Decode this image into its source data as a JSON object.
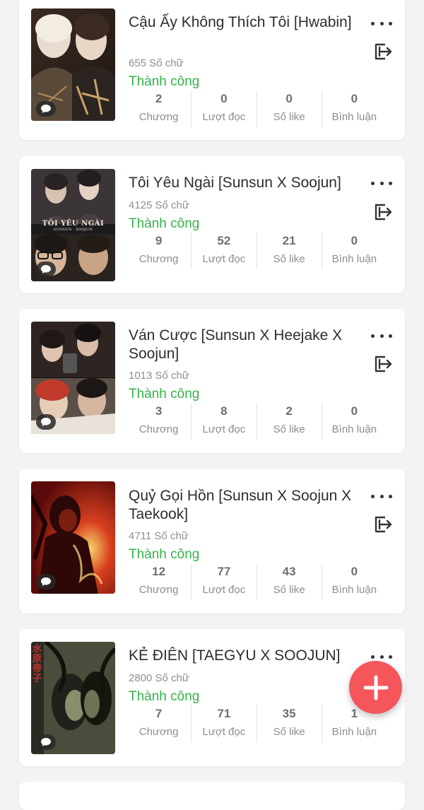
{
  "stories": [
    {
      "title": "Cậu Ấy Không Thích Tôi [Hwabin]",
      "word_count": "655 Số chữ",
      "status": "Thành công",
      "stats": [
        {
          "value": "2",
          "label": "Chương"
        },
        {
          "value": "0",
          "label": "Lượt đọc"
        },
        {
          "value": "0",
          "label": "Số like"
        },
        {
          "value": "0",
          "label": "Bình luận"
        }
      ]
    },
    {
      "title": "Tôi Yêu Ngài [Sunsun X Soojun]",
      "word_count": "4125 Số chữ",
      "status": "Thành công",
      "cover_caption": "TÔI YÊU NGÀI",
      "cover_subcaption": "SUNSUN · SOOJUN",
      "stats": [
        {
          "value": "9",
          "label": "Chương"
        },
        {
          "value": "52",
          "label": "Lượt đọc"
        },
        {
          "value": "21",
          "label": "Số like"
        },
        {
          "value": "0",
          "label": "Bình luận"
        }
      ]
    },
    {
      "title": "Ván Cược [Sunsun X Heejake X Soojun]",
      "word_count": "1013 Số chữ",
      "status": "Thành công",
      "stats": [
        {
          "value": "3",
          "label": "Chương"
        },
        {
          "value": "8",
          "label": "Lượt đọc"
        },
        {
          "value": "2",
          "label": "Số like"
        },
        {
          "value": "0",
          "label": "Bình luận"
        }
      ]
    },
    {
      "title": "Quỷ Gọi Hồn [Sunsun X Soojun X Taekook]",
      "word_count": "4711 Số chữ",
      "status": "Thành công",
      "stats": [
        {
          "value": "12",
          "label": "Chương"
        },
        {
          "value": "77",
          "label": "Lượt đọc"
        },
        {
          "value": "43",
          "label": "Số like"
        },
        {
          "value": "0",
          "label": "Bình luận"
        }
      ]
    },
    {
      "title": "KẺ ĐIÊN [TAEGYU X SOOJUN]",
      "word_count": "2800 Số chữ",
      "status": "Thành công",
      "cover_kanji": "水原帝子",
      "stats": [
        {
          "value": "7",
          "label": "Chương"
        },
        {
          "value": "71",
          "label": "Lượt đọc"
        },
        {
          "value": "35",
          "label": "Số like"
        },
        {
          "value": "1",
          "label": "Bình luận"
        }
      ]
    }
  ],
  "icons": {
    "more": "more-icon",
    "move": "move-out-icon",
    "comment": "comment-icon",
    "add": "add-icon"
  },
  "colors": {
    "status": "#35b24a",
    "fab": "#f5565b",
    "background": "#f3f3f3"
  }
}
